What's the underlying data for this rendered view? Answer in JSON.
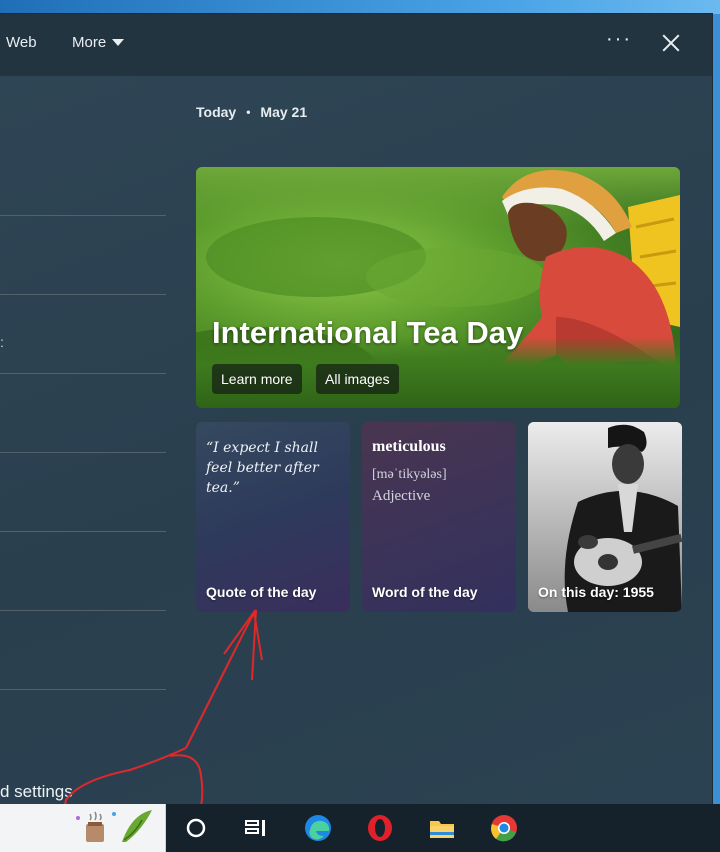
{
  "header": {
    "web_label": "Web",
    "more_label": "More",
    "more_options_icon": "ellipsis-icon",
    "close_icon": "close-icon"
  },
  "left_pane": {
    "colon_fragment": ":",
    "settings_fragment": "d settings"
  },
  "today": {
    "label": "Today",
    "separator": "•",
    "date": "May 21"
  },
  "hero": {
    "title": "International Tea Day",
    "learn_more": "Learn more",
    "all_images": "All images"
  },
  "cards": {
    "quote": {
      "text": "“I expect I shall feel better after tea.”",
      "label": "Quote of the day"
    },
    "word": {
      "word": "meticulous",
      "pronunciation": "[məˈtikyələs]",
      "part_of_speech": "Adjective",
      "label": "Word of the day"
    },
    "history": {
      "label": "On this day: 1955"
    }
  },
  "taskbar": {
    "icons": [
      "search-cortana-icon",
      "task-view-icon",
      "edge-icon",
      "opera-icon",
      "file-explorer-icon",
      "chrome-icon"
    ]
  },
  "colors": {
    "window_bg": "#2f4656",
    "topbar_bg": "#223440",
    "taskbar_bg": "#15222b",
    "annotation": "#e0282a"
  }
}
